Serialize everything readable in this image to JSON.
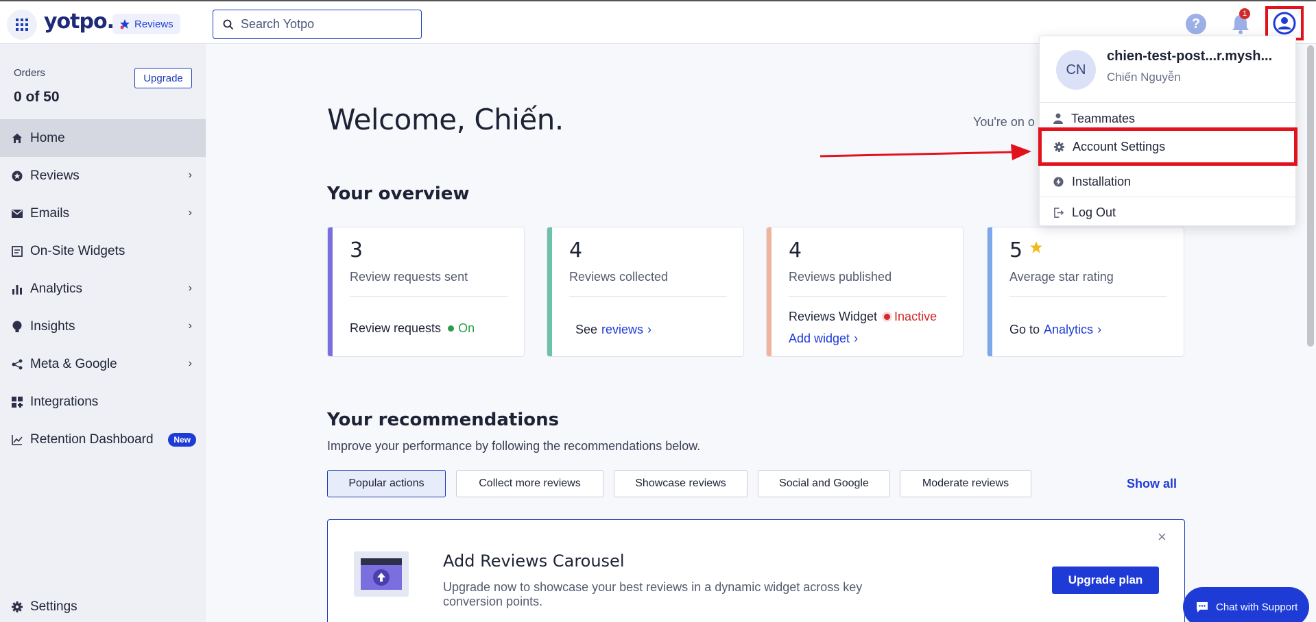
{
  "topbar": {
    "logo": "yotpo.",
    "product": "Reviews",
    "search_placeholder": "Search Yotpo",
    "help": "?",
    "notification_count": "1"
  },
  "sidebar": {
    "orders_label": "Orders",
    "orders_count": "0 of 50",
    "upgrade": "Upgrade",
    "items": [
      {
        "label": "Home",
        "icon": "home-icon",
        "active": true
      },
      {
        "label": "Reviews",
        "icon": "star-circle-icon",
        "chevron": true
      },
      {
        "label": "Emails",
        "icon": "mail-icon",
        "chevron": true
      },
      {
        "label": "On-Site Widgets",
        "icon": "widget-icon"
      },
      {
        "label": "Analytics",
        "icon": "bar-chart-icon",
        "chevron": true
      },
      {
        "label": "Insights",
        "icon": "lightbulb-icon",
        "chevron": true
      },
      {
        "label": "Meta & Google",
        "icon": "share-icon",
        "chevron": true
      },
      {
        "label": "Integrations",
        "icon": "grid-plus-icon"
      },
      {
        "label": "Retention Dashboard",
        "icon": "trend-icon",
        "badge": "New"
      }
    ],
    "settings": "Settings"
  },
  "main": {
    "welcome": "Welcome, Chiến.",
    "plan_text": "You're on o",
    "overview_title": "Your overview",
    "cards": [
      {
        "value": "3",
        "label": "Review requests sent",
        "foot_text": "Review requests",
        "status": "On",
        "color": "#7b6fe0"
      },
      {
        "value": "4",
        "label": "Reviews collected",
        "foot_prefix": "See",
        "foot_link": "reviews",
        "color": "#6cc2a8"
      },
      {
        "value": "4",
        "label": "Reviews published",
        "foot_text": "Reviews Widget",
        "status": "Inactive",
        "foot_link": "Add widget",
        "color": "#f2b39c"
      },
      {
        "value": "5",
        "label": "Average star rating",
        "foot_prefix": "Go to",
        "foot_link": "Analytics",
        "color": "#7aa8ea"
      }
    ],
    "rec_title": "Your recommendations",
    "rec_sub": "Improve your performance by following the recommendations below.",
    "tabs": [
      "Popular actions",
      "Collect more reviews",
      "Showcase reviews",
      "Social and Google",
      "Moderate reviews"
    ],
    "show_all": "Show all",
    "promo": {
      "title": "Add Reviews Carousel",
      "desc": "Upgrade now to showcase your best reviews in a dynamic widget across key conversion points.",
      "cta": "Upgrade plan"
    },
    "chat": "Chat with Support"
  },
  "dropdown": {
    "initials": "CN",
    "store": "chien-test-post...r.mysh...",
    "user": "Chiến Nguyễn",
    "items": [
      "Teammates",
      "Account Settings",
      "Installation",
      "Log Out"
    ]
  },
  "colors": {
    "accent": "#1e3bd6",
    "highlight": "#e2121d"
  }
}
